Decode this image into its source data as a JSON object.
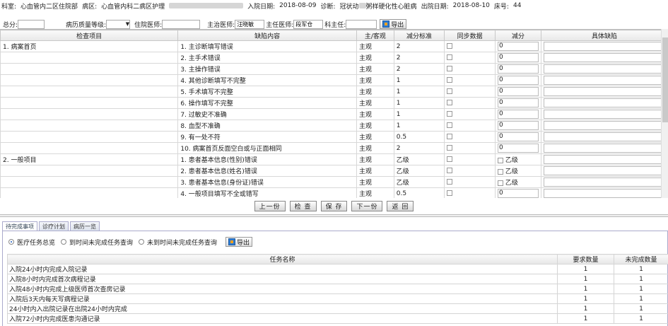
{
  "patient": {
    "dept_label": "科室:",
    "dept_value": "心血管内二区住院部",
    "ward_label": "病区:",
    "ward_value": "心血管内科二病区护理",
    "admit_label": "入院日期:",
    "admit_value": "2018-08-09",
    "diag_label": "诊断:",
    "diag_value_a": "冠状动",
    "diag_value_b": "粥样硬化性心脏病",
    "discharge_label": "出院日期:",
    "discharge_value": "2018-08-10",
    "bed_label": "床号:",
    "bed_value": "44"
  },
  "score": {
    "total_label": "总分:",
    "total_value": "",
    "grade_label": "病历质量等级:",
    "grade_value": "",
    "resident_label": "住院医师:",
    "resident_value": "",
    "attending_label": "主治医师:",
    "attending_value": "汪晓敏",
    "chief_label": "主任医师:",
    "chief_value": "段军仓",
    "director_label": "科主任:",
    "director_value": "",
    "export_label": "导出"
  },
  "table": {
    "headers": [
      "检查项目",
      "缺陷内容",
      "主/客观",
      "减分标准",
      "同步数据",
      "减分",
      "具体缺陷"
    ],
    "rows": [
      {
        "category": "1. 病案首页",
        "item": "1. 主诊断填写错误",
        "type": "主观",
        "std": "2",
        "deduct": "0",
        "grade": ""
      },
      {
        "category": "",
        "item": "2. 主手术错误",
        "type": "主观",
        "std": "2",
        "deduct": "0",
        "grade": ""
      },
      {
        "category": "",
        "item": "3. 主操作错误",
        "type": "主观",
        "std": "2",
        "deduct": "0",
        "grade": ""
      },
      {
        "category": "",
        "item": "4. 其他诊断填写不完整",
        "type": "主观",
        "std": "1",
        "deduct": "0",
        "grade": ""
      },
      {
        "category": "",
        "item": "5. 手术填写不完整",
        "type": "主观",
        "std": "1",
        "deduct": "0",
        "grade": ""
      },
      {
        "category": "",
        "item": "6. 操作填写不完整",
        "type": "主观",
        "std": "1",
        "deduct": "0",
        "grade": ""
      },
      {
        "category": "",
        "item": "7. 过敏史不准确",
        "type": "主观",
        "std": "1",
        "deduct": "0",
        "grade": ""
      },
      {
        "category": "",
        "item": "8. 血型不准确",
        "type": "主观",
        "std": "1",
        "deduct": "0",
        "grade": ""
      },
      {
        "category": "",
        "item": "9. 有一处不符",
        "type": "主观",
        "std": "0.5",
        "deduct": "0",
        "grade": ""
      },
      {
        "category": "",
        "item": "10. 病案首页反面空白或与正面相同",
        "type": "主观",
        "std": "2",
        "deduct": "0",
        "grade": ""
      },
      {
        "category": "2. 一般项目",
        "item": "1. 患者基本信息(性别)错误",
        "type": "主观",
        "std": "乙级",
        "deduct": "",
        "grade": "乙级"
      },
      {
        "category": "",
        "item": "2. 患者基本信息(姓名)错误",
        "type": "主观",
        "std": "乙级",
        "deduct": "",
        "grade": "乙级"
      },
      {
        "category": "",
        "item": "3. 患者基本信息(身份证)错误",
        "type": "主观",
        "std": "乙级",
        "deduct": "",
        "grade": "乙级"
      },
      {
        "category": "",
        "item": "4. 一般项目填写不全或错写",
        "type": "主观",
        "std": "0.5",
        "deduct": "0",
        "grade": ""
      }
    ]
  },
  "buttons": {
    "prev": "上一份",
    "check": "检 查",
    "save": "保 存",
    "next": "下一份",
    "back": "返 回"
  },
  "tabs": [
    "待完成事项",
    "诊疗计划",
    "病历一览"
  ],
  "radios": [
    "医疗任务总览",
    "到时间未完成任务查询",
    "未到时间未完成任务查询"
  ],
  "task_export": "导出",
  "tasks": {
    "headers": [
      "任务名称",
      "要求数量",
      "未完成数量"
    ],
    "rows": [
      {
        "name": "入院24小时内完成入院记录",
        "req": "1",
        "undone": "1"
      },
      {
        "name": "入院8小时内完成首次病程记录",
        "req": "1",
        "undone": "1"
      },
      {
        "name": "入院48小时内完成上级医师首次查房记录",
        "req": "1",
        "undone": "1"
      },
      {
        "name": "入院后3天内每天写病程记录",
        "req": "1",
        "undone": "1"
      },
      {
        "name": "24小时内入出院记录在出院24小时内完成",
        "req": "1",
        "undone": "1"
      },
      {
        "name": "入院72小时内完成医患沟通记录",
        "req": "1",
        "undone": "1"
      }
    ]
  }
}
